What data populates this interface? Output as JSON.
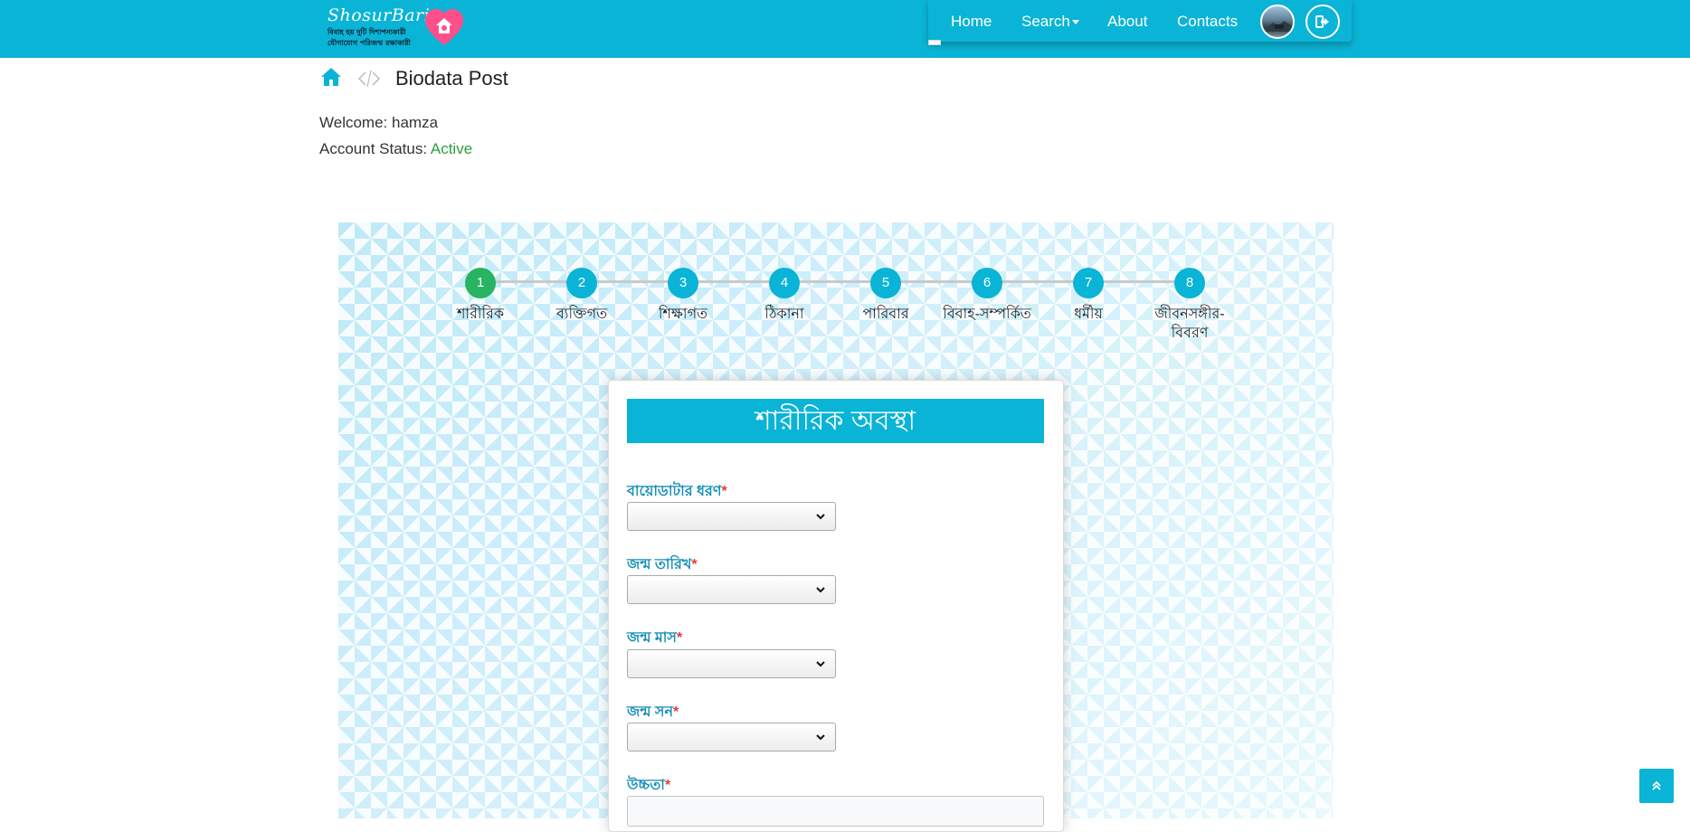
{
  "brand": {
    "name": "ShosurBari",
    "tagline_1": "বিবাহ হয় দুটি দিশাপন্যকারী",
    "tagline_2": "যৌগাযোগ পরিজন্ম রক্ষাকারী"
  },
  "nav": {
    "home": "Home",
    "search": "Search",
    "about": "About",
    "contacts": "Contacts"
  },
  "breadcrumb": {
    "title": "Biodata Post"
  },
  "user": {
    "welcome_label": "Welcome:",
    "username": "hamza",
    "status_label": "Account Status:",
    "status_value": "Active"
  },
  "steps": [
    {
      "num": "1",
      "label": "শারীরিক"
    },
    {
      "num": "2",
      "label": "ব্যক্তিগত"
    },
    {
      "num": "3",
      "label": "শিক্ষাগত"
    },
    {
      "num": "4",
      "label": "ঠিকানা"
    },
    {
      "num": "5",
      "label": "পারিবার"
    },
    {
      "num": "6",
      "label": "বিবাহ-সম্পর্কিত"
    },
    {
      "num": "7",
      "label": "ধর্মীয়"
    },
    {
      "num": "8",
      "label": "জীবনসঙ্গীর-বিবরণ"
    }
  ],
  "current_step": 1,
  "form": {
    "title": "শারীরিক অবস্থা",
    "required_mark": "*",
    "fields": [
      {
        "label": "বায়োডাটার ধরণ",
        "value": ""
      },
      {
        "label": "জন্ম তারিখ",
        "value": ""
      },
      {
        "label": "জন্ম মাস",
        "value": ""
      },
      {
        "label": "জন্ম সন",
        "value": ""
      },
      {
        "label": "উচ্চতা",
        "value": ""
      }
    ]
  },
  "colors": {
    "primary": "#0ab4d6",
    "step_current": "#28b463",
    "active_status": "#2e9e3e",
    "required": "#e53935",
    "label": "#1690b8"
  },
  "icons": {
    "home": "home-icon",
    "logout": "logout-icon",
    "scroll_top": "double-chevron-up-icon",
    "separator": "code-brackets-icon"
  }
}
